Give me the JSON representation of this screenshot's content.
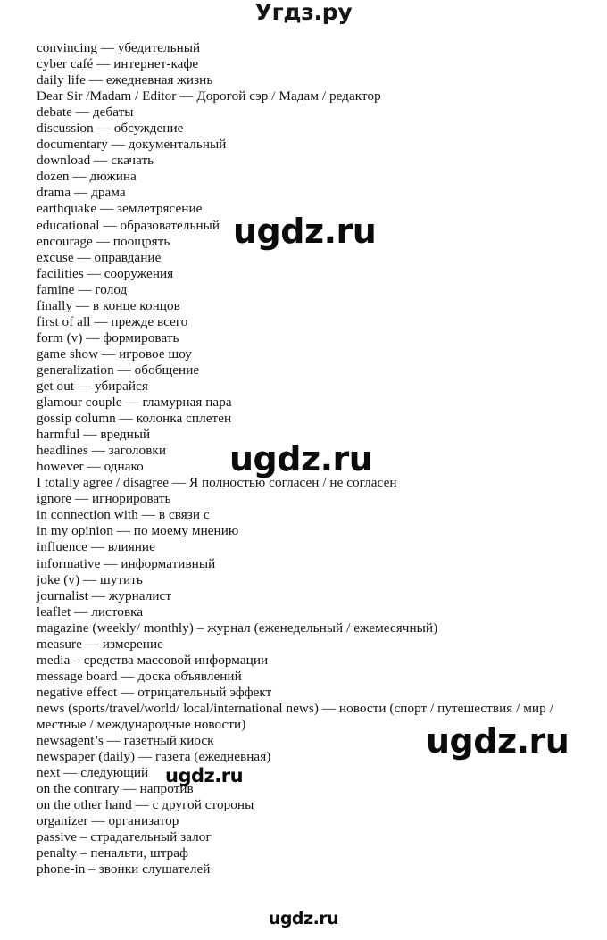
{
  "page": {
    "header_watermark": "Угдз.ру",
    "footer_watermark": "ugdz.ru"
  },
  "watermarks": {
    "overlay_1": "ugdz.ru",
    "overlay_2": "ugdz.ru",
    "overlay_3": "ugdz.ru",
    "overlay_4": "ugdz.ru"
  },
  "glossary": {
    "lines": [
      "convincing — убедительный",
      "cyber café — интернет-кафе",
      "daily life — ежедневная жизнь",
      "Dear Sir /Madam / Editor — Дорогой сэр / Мадам / редактор",
      "debate — дебаты",
      "discussion — обсуждение",
      "documentary — документальный",
      "download — скачать",
      "dozen — дюжина",
      "drama — драма",
      "earthquake — землетрясение",
      "educational — образовательный",
      "encourage — поощрять",
      "excuse — оправдание",
      "facilities — сооружения",
      "famine — голод",
      "finally — в конце концов",
      "first of all — прежде всего",
      "form (v) — формировать",
      "game show — игровое шоу",
      "generalization — обобщение",
      "get out — убирайся",
      "glamour couple — гламурная пара",
      "gossip column — колонка сплетен",
      "harmful — вредный",
      "headlines — заголовки",
      "however — однако",
      "I totally agree / disagree — Я полностью согласен / не согласен",
      "ignore — игнорировать",
      "in connection with — в связи с",
      "in my opinion — по моему мнению",
      "influence — влияние",
      "informative — информативный",
      "joke (v) — шутить",
      "journalist — журналист",
      "leaflet — листовка",
      "magazine (weekly/ monthly) – журнал (еженедельный / ежемесячный)",
      "measure — измерение",
      "media – средства массовой информации",
      "message board — доска объявлений",
      "negative effect — отрицательный эффект",
      "news (sports/travel/world/ local/international news) — новости (спорт / путешествия / мир /",
      "местные / международные новости)",
      "newsagent’s — газетный киоск",
      "newspaper (daily) — газета (ежедневная)",
      "next — следующий",
      "on the contrary — напротив",
      "on the other hand — с другой стороны",
      "organizer — организатор",
      "passive – страдательный залог",
      "penalty – пенальти, штраф",
      "phone-in – звонки слушателей"
    ]
  }
}
